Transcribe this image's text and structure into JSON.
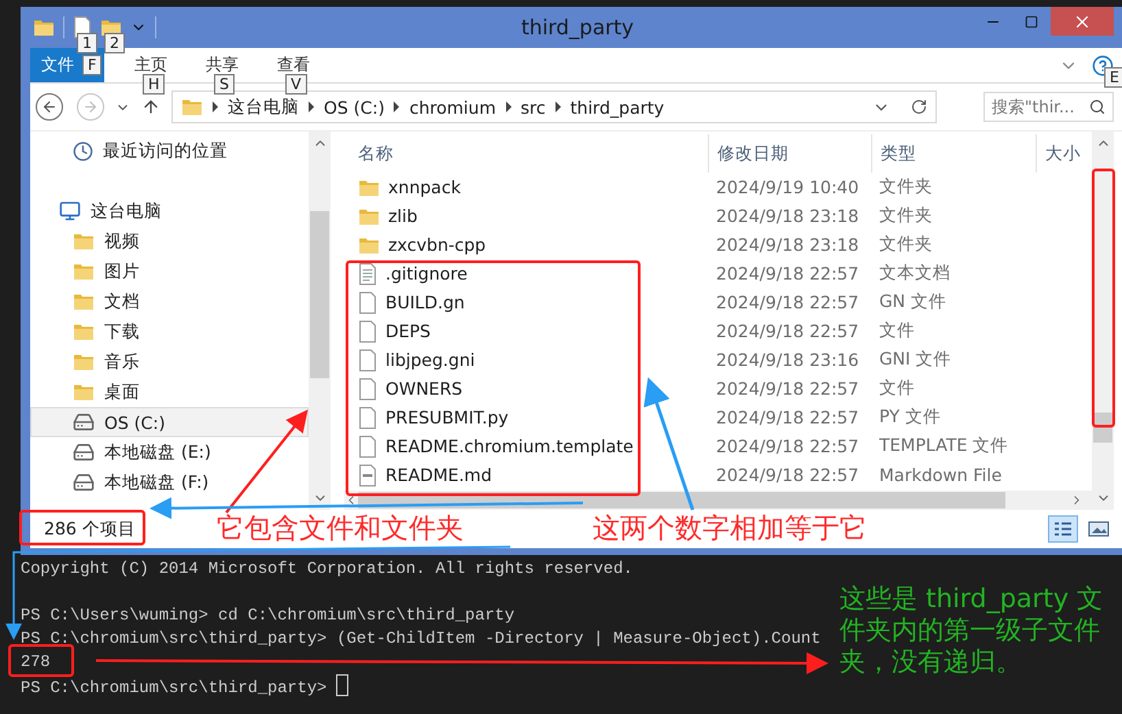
{
  "window": {
    "title": "third_party",
    "quick_access_keytips": [
      "1",
      "2"
    ]
  },
  "ribbon": {
    "tabs": [
      {
        "label": "文件",
        "keytip": "F",
        "kind": "file"
      },
      {
        "label": "主页",
        "keytip": "H",
        "kind": "tab"
      },
      {
        "label": "共享",
        "keytip": "S",
        "kind": "tab"
      },
      {
        "label": "查看",
        "keytip": "V",
        "kind": "tab"
      }
    ],
    "help_keytip": "E"
  },
  "address": {
    "crumbs": [
      "这台电脑",
      "OS (C:)",
      "chromium",
      "src",
      "third_party"
    ],
    "search_placeholder": "搜索\"thir..."
  },
  "navigation": [
    {
      "label": "最近访问的位置",
      "kind": "recent",
      "selected": false
    },
    {
      "label": "这台电脑",
      "kind": "computer",
      "selected": false
    },
    {
      "label": "视频",
      "kind": "videos",
      "selected": false
    },
    {
      "label": "图片",
      "kind": "pictures",
      "selected": false
    },
    {
      "label": "文档",
      "kind": "documents",
      "selected": false
    },
    {
      "label": "下载",
      "kind": "downloads",
      "selected": false
    },
    {
      "label": "音乐",
      "kind": "music",
      "selected": false
    },
    {
      "label": "桌面",
      "kind": "desktop",
      "selected": false
    },
    {
      "label": "OS (C:)",
      "kind": "drive",
      "selected": true
    },
    {
      "label": "本地磁盘 (E:)",
      "kind": "drive",
      "selected": false
    },
    {
      "label": "本地磁盘 (F:)",
      "kind": "drive",
      "selected": false
    }
  ],
  "file_list": {
    "columns": [
      "名称",
      "修改日期",
      "类型",
      "大小"
    ],
    "rows": [
      {
        "name": "xnnpack",
        "modified": "2024/9/19 10:40",
        "type": "文件夹",
        "kind": "folder"
      },
      {
        "name": "zlib",
        "modified": "2024/9/18 23:18",
        "type": "文件夹",
        "kind": "folder"
      },
      {
        "name": "zxcvbn-cpp",
        "modified": "2024/9/18 23:18",
        "type": "文件夹",
        "kind": "folder"
      },
      {
        "name": ".gitignore",
        "modified": "2024/9/18 22:57",
        "type": "文本文档",
        "kind": "text"
      },
      {
        "name": "BUILD.gn",
        "modified": "2024/9/18 22:57",
        "type": "GN 文件",
        "kind": "file"
      },
      {
        "name": "DEPS",
        "modified": "2024/9/18 22:57",
        "type": "文件",
        "kind": "file"
      },
      {
        "name": "libjpeg.gni",
        "modified": "2024/9/18 23:16",
        "type": "GNI 文件",
        "kind": "file"
      },
      {
        "name": "OWNERS",
        "modified": "2024/9/18 22:57",
        "type": "文件",
        "kind": "file"
      },
      {
        "name": "PRESUBMIT.py",
        "modified": "2024/9/18 22:57",
        "type": "PY 文件",
        "kind": "file"
      },
      {
        "name": "README.chromium.template",
        "modified": "2024/9/18 22:57",
        "type": "TEMPLATE 文件",
        "kind": "file"
      },
      {
        "name": "README.md",
        "modified": "2024/9/18 22:57",
        "type": "Markdown File",
        "kind": "markdown"
      }
    ]
  },
  "status_bar": {
    "item_count": "286 个项目"
  },
  "terminal": {
    "banner": "Copyright (C) 2014 Microsoft Corporation. All rights reserved.",
    "lines": [
      "PS C:\\Users\\wuming> cd C:\\chromium\\src\\third_party",
      "PS C:\\chromium\\src\\third_party> (Get-ChildItem -Directory | Measure-Object).Count",
      "278",
      "PS C:\\chromium\\src\\third_party>"
    ]
  },
  "annotations": [
    {
      "text": "它包含文件和文件夹",
      "color": "#ff2a2a"
    },
    {
      "text": "这两个数字相加等于它",
      "color": "#ff2a2a"
    },
    {
      "text": "这些是 third_party 文件夹内的第一级子文件夹，没有递归。",
      "color": "#22b422"
    }
  ]
}
